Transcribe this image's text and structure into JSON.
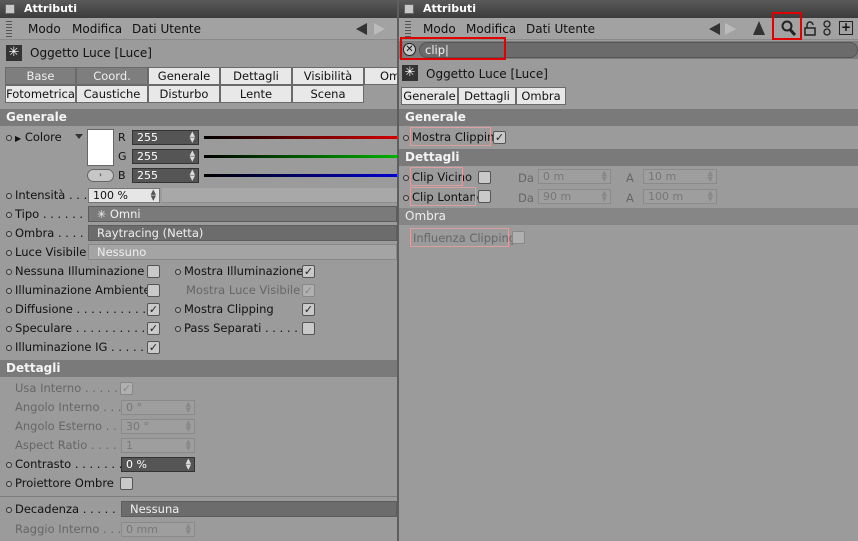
{
  "left": {
    "title": "Attributi",
    "menu": [
      "Modo",
      "Modifica",
      "Dati Utente"
    ],
    "object": "Oggetto Luce [Luce]",
    "tabs_row1": [
      "Base",
      "Coord.",
      "Generale",
      "Dettagli",
      "Visibilità",
      "Om"
    ],
    "tabs_row2": [
      "Fotometrica",
      "Caustiche",
      "Disturbo",
      "Lente",
      "Scena"
    ],
    "sec_generale": "Generale",
    "colore": "Colore",
    "r_label": "R",
    "g_label": "G",
    "b_label": "B",
    "r": "255",
    "g": "255",
    "b": "255",
    "intensita_label": "Intensità",
    "intensita": "100 %",
    "tipo_label": "Tipo",
    "tipo": "Omni",
    "ombra_label": "Ombra",
    "ombra": "Raytracing (Netta)",
    "luce_label": "Luce Visibile",
    "luce": "Nessuno",
    "nessuna": "Nessuna Illuminazione",
    "mostra_ill": "Mostra Illuminazione",
    "ill_amb": "Illuminazione Ambiente",
    "mostra_luce": "Mostra Luce Visibile",
    "diffusione": "Diffusione",
    "mostra_clip": "Mostra Clipping",
    "speculare": "Speculare",
    "pass_sep": "Pass Separati",
    "ill_ig": "Illuminazione IG",
    "sec_dettagli": "Dettagli",
    "usa_interno": "Usa Interno",
    "angolo_int": "Angolo Interno",
    "angolo_int_v": "0 °",
    "angolo_est": "Angolo Esterno",
    "angolo_est_v": "30 °",
    "aspect": "Aspect Ratio",
    "aspect_v": "1",
    "contrasto": "Contrasto",
    "contrasto_v": "0 %",
    "proiettore": "Proiettore Ombre",
    "decadenza": "Decadenza",
    "decadenza_v": "Nessuna",
    "raggio": "Raggio Interno",
    "raggio_v": "0 mm"
  },
  "right": {
    "title": "Attributi",
    "menu": [
      "Modo",
      "Modifica",
      "Dati Utente"
    ],
    "search": "clip",
    "object": "Oggetto Luce [Luce]",
    "tabs": [
      "Generale",
      "Dettagli",
      "Ombra"
    ],
    "sec_generale": "Generale",
    "mostra_clip": "Mostra Clipping",
    "sec_dettagli": "Dettagli",
    "clip_vicino": "Clip Vicino",
    "clip_lontano": "Clip Lontano",
    "da": "Da",
    "a": "A",
    "cv_da": "0 m",
    "cv_a": "10 m",
    "cl_da": "90 m",
    "cl_a": "100 m",
    "sec_ombra": "Ombra",
    "influenza": "Influenza Clipping"
  }
}
